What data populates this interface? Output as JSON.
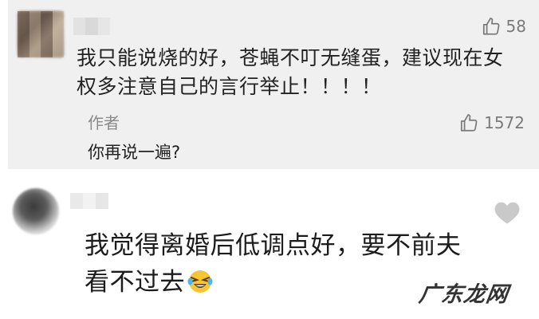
{
  "comment_1": {
    "like_count": "58",
    "text": "我只能说烧的好，苍蝇不叮无缝蛋，建议现在女权多注意自己的言行举止！！！！",
    "reply": {
      "author_label": "作者",
      "like_count": "1572",
      "text": "你再说一遍?"
    }
  },
  "comment_2": {
    "text": "我觉得离婚后低调点好，要不前夫看不过去",
    "emoji": "laughing-tears-emoji"
  },
  "watermark": "广东龙网",
  "colors": {
    "highlight_background": "#f0f0f1",
    "muted_text": "#8a8a8a",
    "primary_text": "#222222",
    "icon_grey": "#7a7a7a",
    "heart_grey": "#c9c9c9"
  },
  "icons": [
    "thumbs-up-icon",
    "heart-icon",
    "laughing-tears-emoji"
  ]
}
